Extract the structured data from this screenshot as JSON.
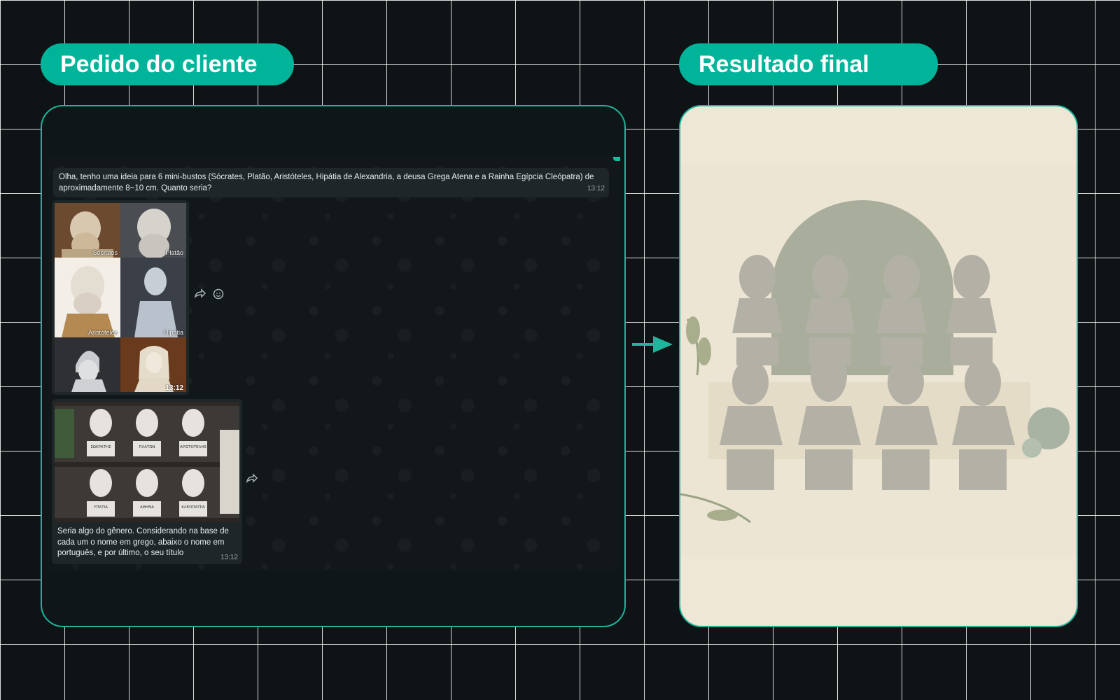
{
  "labels": {
    "left_title": "Pedido do cliente",
    "right_title": "Resultado final"
  },
  "chat": {
    "first_message": {
      "text": "Olha, tenho uma ideia para 6 mini-bustos (Sócrates, Platão, Aristóteles, Hipátia de Alexandria, a deusa Grega Atena e a Rainha Egípcia Cleópatra) de aproximadamente 8~10 cm. Quanto seria?",
      "time": "13:12"
    },
    "image_grid": {
      "tiles": [
        {
          "label": "Sócrates"
        },
        {
          "label": "Platão"
        },
        {
          "label": "Aristóteles"
        },
        {
          "label": "Hipátia"
        },
        {
          "label": ""
        },
        {
          "label": ""
        }
      ],
      "time": "13:12"
    },
    "reference_message": {
      "caption": "Seria algo do gênero. Considerando na base de cada um o nome em grego, abaixo o nome em português, e por último, o seu título",
      "time": "13:12",
      "plaques": [
        "ΣΩΚΡΑΤΗΣ",
        "ΠΛΑΤΩΝ",
        "ΑΡΙΣΤΟΤΕΛΗΣ",
        "ΥΠΑΤΙΑ",
        "ΑΘΗΝΑ",
        "ΚΛΕΟΠΑΤΡΑ"
      ]
    }
  },
  "colors": {
    "accent": "#00b49a",
    "background": "#0e1416",
    "bubble": "#1f2628",
    "final_background": "#efe7d6"
  },
  "icons": [
    "forward-icon",
    "emoji-icon",
    "arrow-right-icon"
  ]
}
